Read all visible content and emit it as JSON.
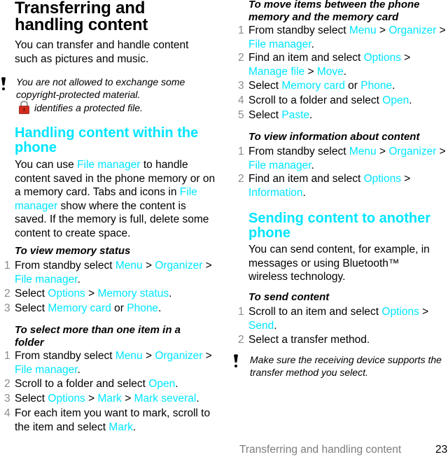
{
  "page": {
    "title": "Transferring and handling content",
    "intro": "You can transfer and handle content such as pictures and music.",
    "note1": {
      "icon": "warning-icon",
      "text1": "You are not allowed to exchange some copyright-protected material.",
      "lock_icon": "lock-icon",
      "text2": "identifies a protected file."
    },
    "section1": {
      "heading": "Handling content within the phone",
      "para": {
        "t1": "You can use ",
        "l1": "File manager",
        "t2": " to handle content saved in the phone memory or on a memory card. Tabs and icons in ",
        "l2": "File manager",
        "t3": " show where the content is saved. If the memory is full, delete some content to create space."
      }
    },
    "proc_memory_status": {
      "title": "To view memory status",
      "steps": [
        {
          "num": "1",
          "t1": "From standby select ",
          "l1": "Menu",
          "t2": " > ",
          "l2": "Organizer",
          "t3": " > ",
          "l3": "File manager",
          "t4": "."
        },
        {
          "num": "2",
          "t1": "Select ",
          "l1": "Options",
          "t2": " > ",
          "l2": "Memory status",
          "t3": "."
        },
        {
          "num": "3",
          "t1": "Select ",
          "l1": "Memory card",
          "t2": " or ",
          "l2": "Phone",
          "t3": "."
        }
      ]
    },
    "proc_select_multiple": {
      "title": "To select more than one item in a folder",
      "steps": [
        {
          "num": "1",
          "t1": "From standby select ",
          "l1": "Menu",
          "t2": " > ",
          "l2": "Organizer",
          "t3": " > ",
          "l3": "File manager",
          "t4": "."
        },
        {
          "num": "2",
          "t1": "Scroll to a folder and select ",
          "l1": "Open",
          "t2": "."
        },
        {
          "num": "3",
          "t1": "Select ",
          "l1": "Options",
          "t2": " > ",
          "l2": "Mark",
          "t3": " > ",
          "l3": "Mark several",
          "t4": "."
        },
        {
          "num": "4",
          "t1": "For each item you want to mark, scroll to the item and select ",
          "l1": "Mark",
          "t2": "."
        }
      ]
    },
    "proc_move": {
      "title": "To move items between the phone memory and the memory card",
      "steps": [
        {
          "num": "1",
          "t1": "From standby select ",
          "l1": "Menu",
          "t2": " > ",
          "l2": "Organizer",
          "t3": " > ",
          "l3": "File manager",
          "t4": "."
        },
        {
          "num": "2",
          "t1": "Find an item and select ",
          "l1": "Options",
          "t2": " > ",
          "l2": "Manage file",
          "t3": " > ",
          "l3": "Move",
          "t4": "."
        },
        {
          "num": "3",
          "t1": "Select ",
          "l1": "Memory card",
          "t2": " or ",
          "l2": "Phone",
          "t3": "."
        },
        {
          "num": "4",
          "t1": "Scroll to a folder and select ",
          "l1": "Open",
          "t2": "."
        },
        {
          "num": "5",
          "t1": "Select ",
          "l1": "Paste",
          "t2": "."
        }
      ]
    },
    "proc_info": {
      "title": "To view information about content",
      "steps": [
        {
          "num": "1",
          "t1": "From standby select ",
          "l1": "Menu",
          "t2": " > ",
          "l2": "Organizer",
          "t3": " > ",
          "l3": "File manager",
          "t4": "."
        },
        {
          "num": "2",
          "t1": "Find an item and select ",
          "l1": "Options",
          "t2": " > ",
          "l2": "Information",
          "t3": "."
        }
      ]
    },
    "section2": {
      "heading": "Sending content to another phone",
      "para": "You can send content, for example, in messages or using Bluetooth™ wireless technology."
    },
    "proc_send": {
      "title": "To send content",
      "steps": [
        {
          "num": "1",
          "t1": "Scroll to an item and select ",
          "l1": "Options",
          "t2": " > ",
          "l2": "Send",
          "t3": "."
        },
        {
          "num": "2",
          "t1": "Select a transfer method."
        }
      ]
    },
    "note2": {
      "icon": "warning-icon",
      "text": "Make sure the receiving device supports the transfer method you select."
    },
    "footer": {
      "section": "Transferring and handling content",
      "page_number": "23"
    },
    "colors": {
      "link": "#00e5ff",
      "step_number": "#8c8c8c",
      "footer_text": "#7d7d7d",
      "lock": "#d42a1e"
    }
  }
}
